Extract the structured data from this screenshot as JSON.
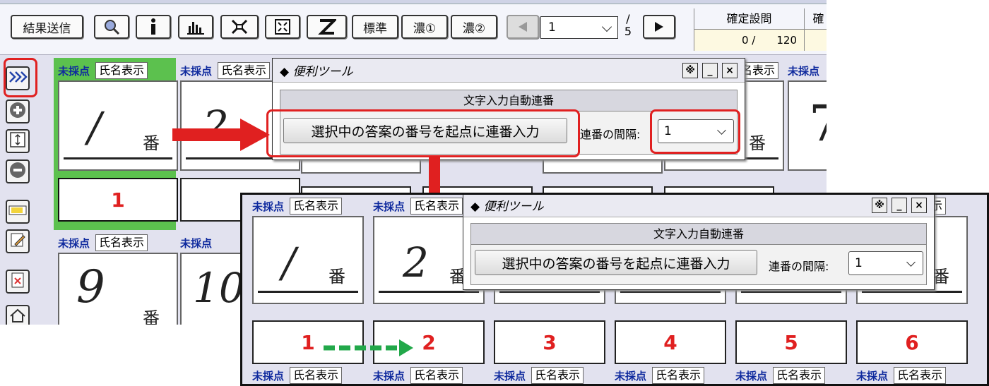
{
  "toolbar": {
    "submit_label": "結果送信",
    "standard_label": "標準",
    "dark1_label": "濃①",
    "dark2_label": "濃②",
    "page_value": "1",
    "page_total": "5",
    "page_sep": "/"
  },
  "stats": {
    "confirmed_header": "確定設問",
    "confirmed_value": "0 /　　120",
    "second_header": "確"
  },
  "card_labels": {
    "unscored": "未採点",
    "show_name": "氏名表示",
    "ban": "番"
  },
  "grid1": {
    "first_number": "1"
  },
  "dialog": {
    "title": "◆ 便利ツール",
    "section_title": "文字入力自動連番",
    "seq_button": "選択中の答案の番号を起点に連番入力",
    "interval_label": "連番の間隔:",
    "interval_value": "1",
    "close_symbol": "×",
    "minimize_symbol": "_",
    "settings_symbol": "※"
  },
  "grid2": {
    "numbers": [
      "1",
      "2",
      "3",
      "4",
      "5",
      "6"
    ]
  },
  "colors": {
    "accent_red": "#e02020",
    "arrow_green": "#22a84a",
    "selected_green": "#5cc14e"
  }
}
